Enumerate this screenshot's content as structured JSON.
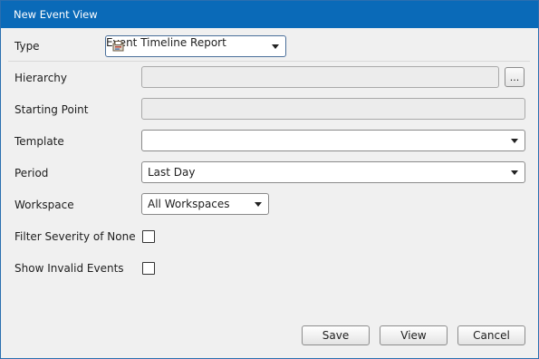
{
  "window": {
    "title": "New Event View"
  },
  "form": {
    "type": {
      "label": "Type",
      "value": "Event Timeline Report",
      "icon": "report-icon"
    },
    "hierarchy": {
      "label": "Hierarchy",
      "value": "",
      "browse_label": "..."
    },
    "starting_point": {
      "label": "Starting Point",
      "value": ""
    },
    "template": {
      "label": "Template",
      "value": ""
    },
    "period": {
      "label": "Period",
      "value": "Last Day"
    },
    "workspace": {
      "label": "Workspace",
      "value": "All Workspaces"
    },
    "filter_severity": {
      "label": "Filter Severity of None",
      "checked": false
    },
    "show_invalid": {
      "label": "Show Invalid Events",
      "checked": false
    }
  },
  "buttons": {
    "save": "Save",
    "view": "View",
    "cancel": "Cancel"
  },
  "colors": {
    "titlebar": "#0a6ab8",
    "background": "#f0f0f0"
  }
}
